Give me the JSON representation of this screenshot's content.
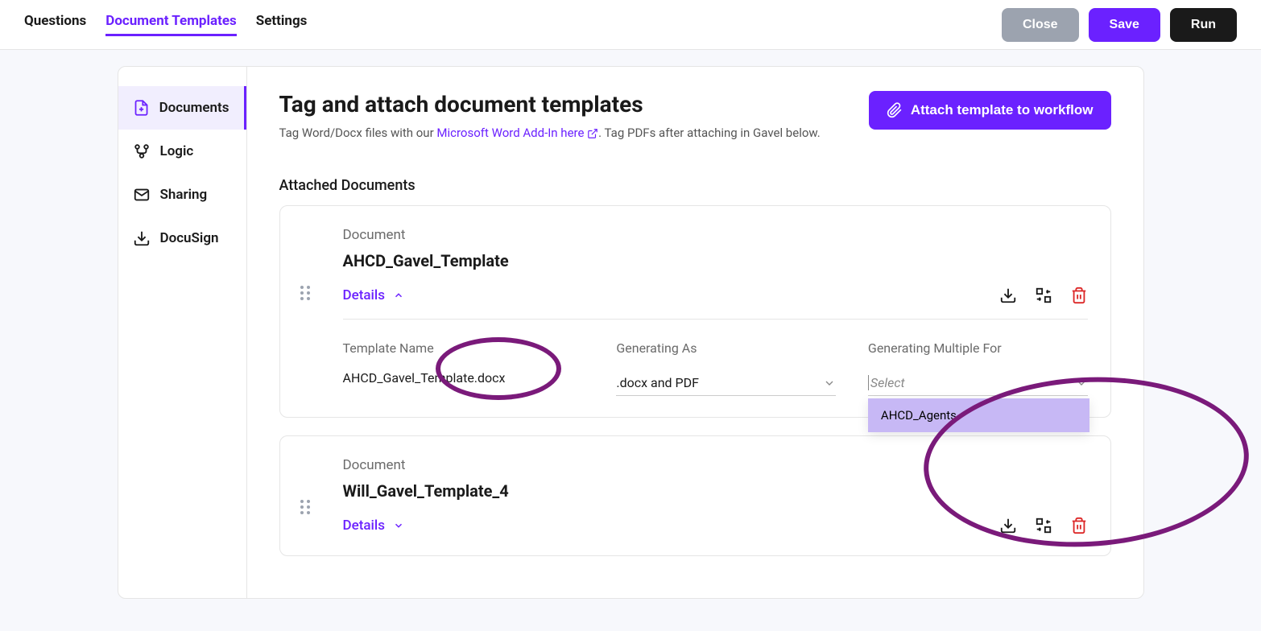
{
  "topnav": {
    "questions": "Questions",
    "document_templates": "Document Templates",
    "settings": "Settings"
  },
  "topbuttons": {
    "close": "Close",
    "save": "Save",
    "run": "Run"
  },
  "sidenav": {
    "documents": "Documents",
    "logic": "Logic",
    "sharing": "Sharing",
    "docusign": "DocuSign"
  },
  "header": {
    "title": "Tag and attach document templates",
    "sub_pre": "Tag Word/Docx files with our ",
    "sub_link": "Microsoft Word Add-In here",
    "sub_post": ". Tag PDFs after attaching in Gavel below.",
    "attach_btn": "Attach template to workflow"
  },
  "section": {
    "attached": "Attached Documents"
  },
  "detail_labels": {
    "document": "Document",
    "details": "Details",
    "template_name": "Template Name",
    "generating_as": "Generating As",
    "generating_multiple": "Generating Multiple For",
    "select_ph": "Select"
  },
  "docs": [
    {
      "name": "AHCD_Gavel_Template",
      "template_name": "AHCD_Gavel_Template.docx",
      "generating_as": ".docx and PDF",
      "multiple_options": [
        "AHCD_Agents"
      ]
    },
    {
      "name": "Will_Gavel_Template_4"
    }
  ]
}
